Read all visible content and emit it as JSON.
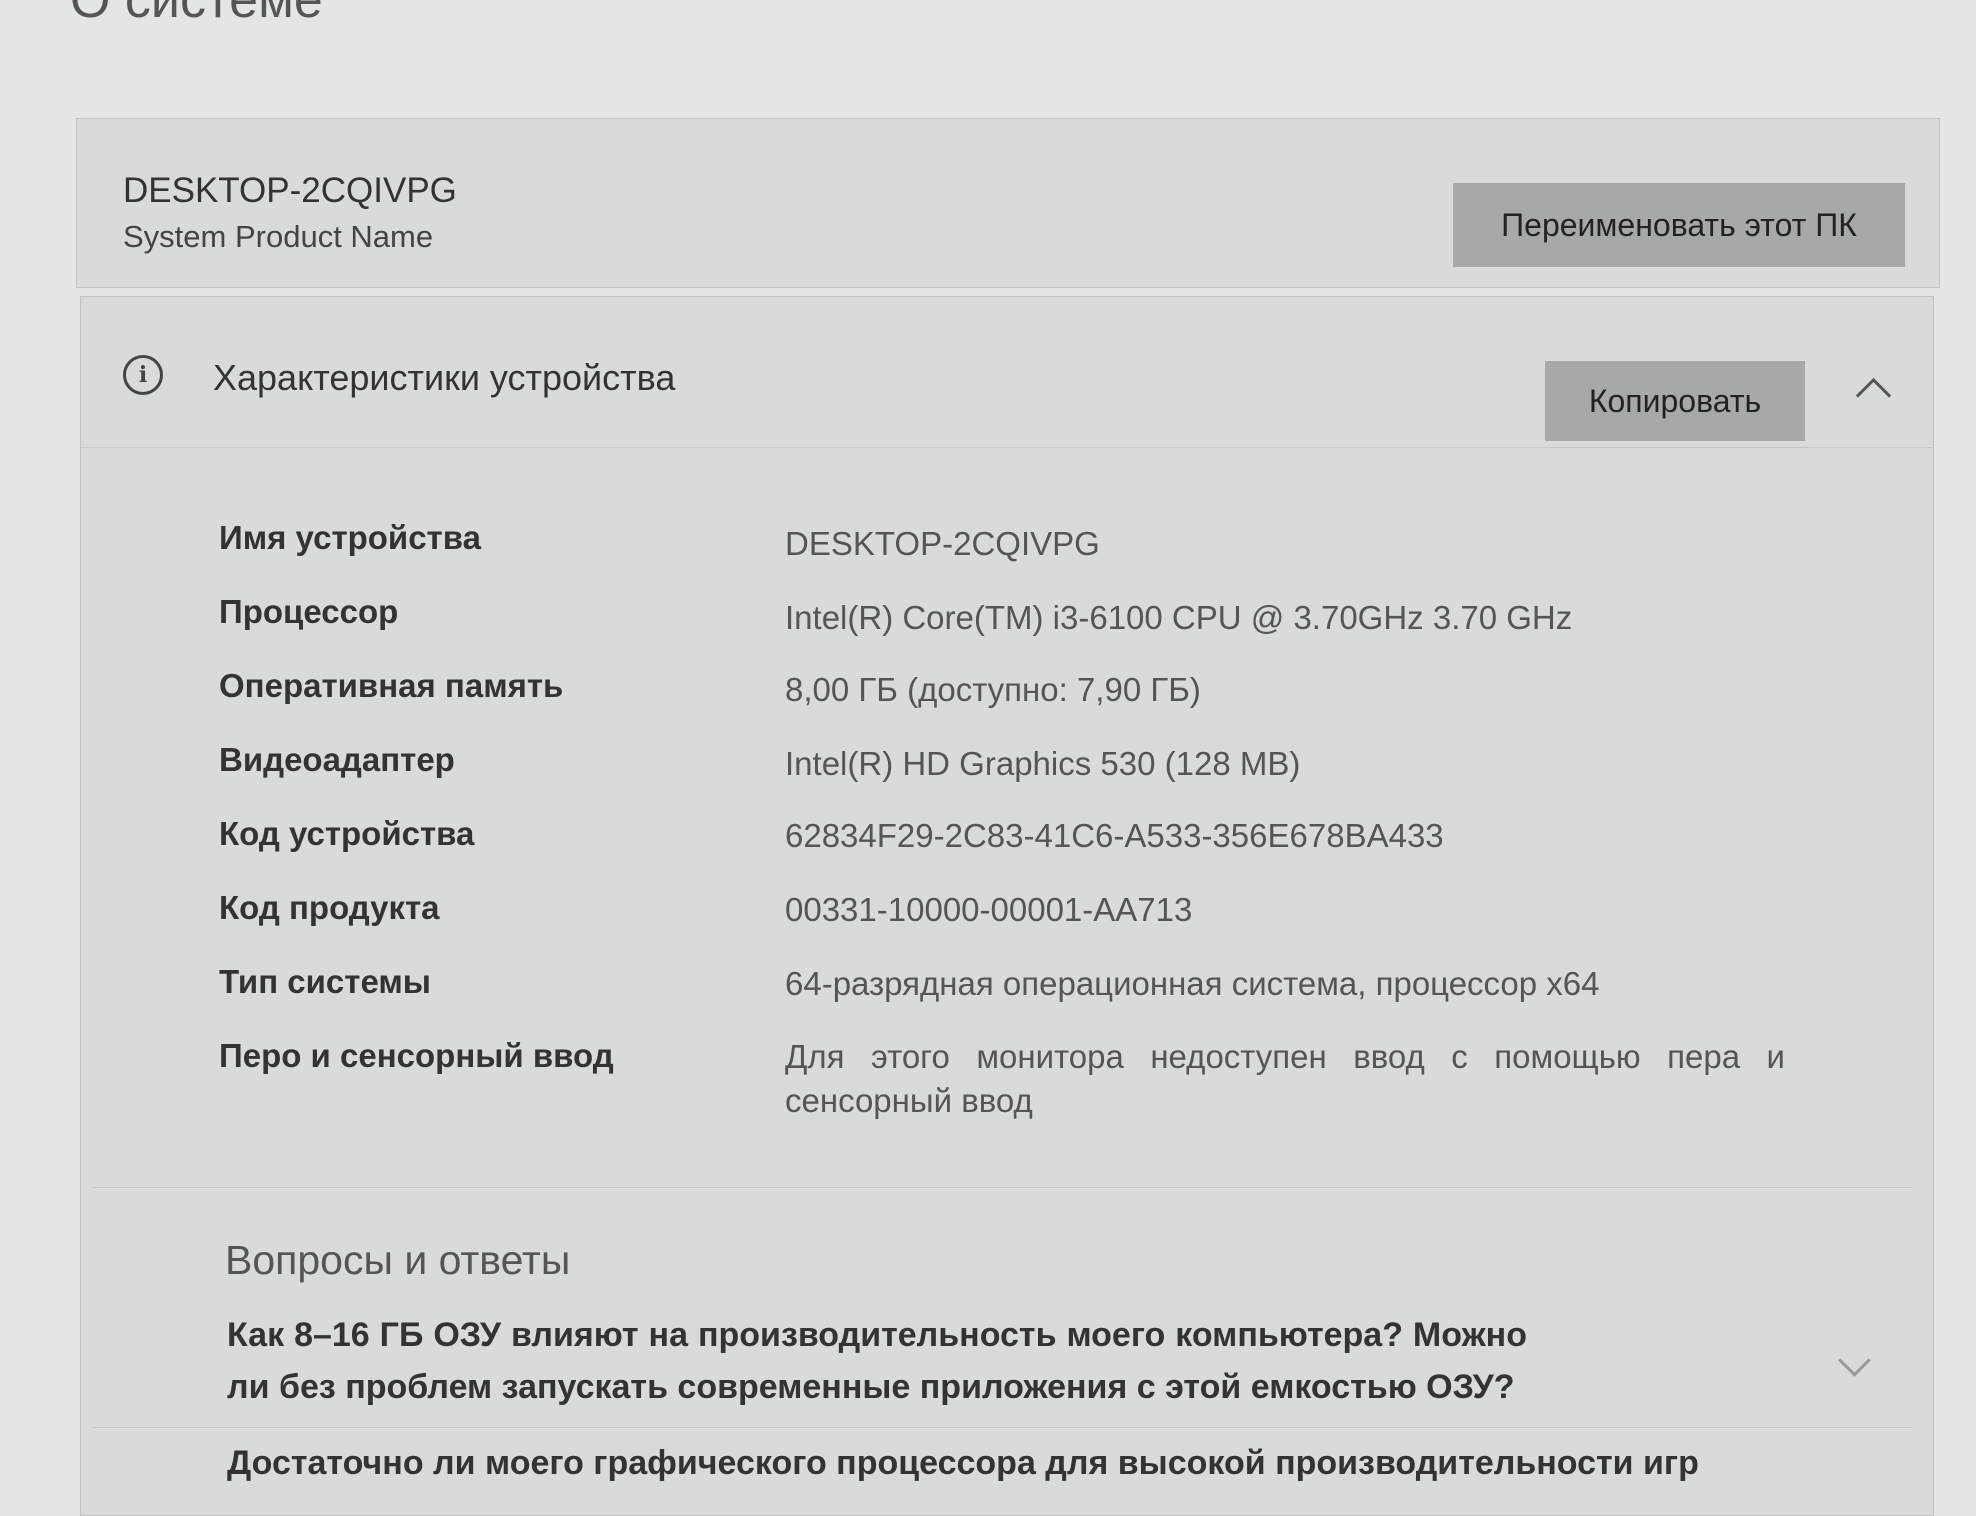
{
  "page": {
    "title": "О системе"
  },
  "pc": {
    "name": "DESKTOP-2CQIVPG",
    "model": "System Product Name",
    "rename_label": "Переименовать этот ПК"
  },
  "specs_section": {
    "title": "Характеристики устройства",
    "copy_label": "Копировать",
    "info_icon": "info-icon",
    "collapse_icon": "chevron-up-icon",
    "rows": [
      {
        "label": "Имя устройства",
        "value": "DESKTOP-2CQIVPG"
      },
      {
        "label": "Процессор",
        "value": "Intel(R) Core(TM) i3-6100 CPU @ 3.70GHz   3.70 GHz"
      },
      {
        "label": "Оперативная память",
        "value": "8,00 ГБ (доступно: 7,90 ГБ)"
      },
      {
        "label": "Видеоадаптер",
        "value": "Intel(R) HD Graphics 530 (128 MB)"
      },
      {
        "label": "Код устройства",
        "value": "62834F29-2C83-41C6-A533-356E678BA433"
      },
      {
        "label": "Код продукта",
        "value": "00331-10000-00001-AA713"
      },
      {
        "label": "Тип системы",
        "value": "64-разрядная операционная система, процессор x64"
      },
      {
        "label": "Перо и сенсорный ввод",
        "value": "Для этого монитора недоступен ввод с помощью пера и сенсорный ввод"
      }
    ]
  },
  "faq": {
    "title": "Вопросы и ответы",
    "items": [
      {
        "question": "Как 8–16 ГБ ОЗУ влияют на производительность моего компьютера? Можно ли без проблем запускать современные приложения с этой емкостью ОЗУ?"
      },
      {
        "question": "Достаточно ли моего графического процессора для высокой производительности игр"
      }
    ]
  }
}
